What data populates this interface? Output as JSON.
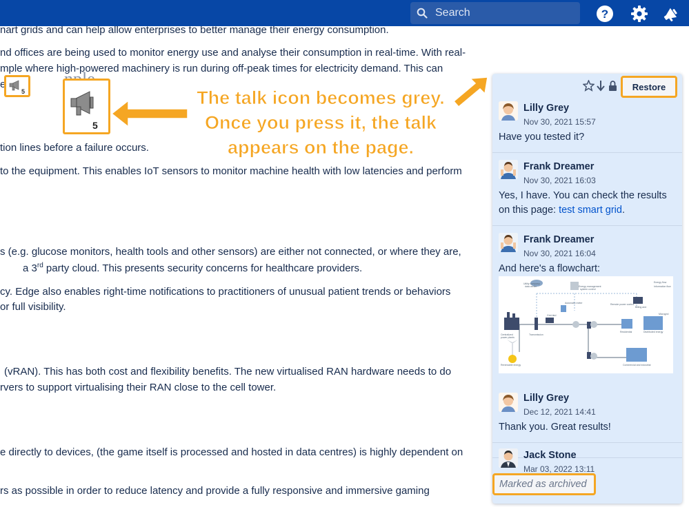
{
  "topbar": {
    "search_placeholder": "Search",
    "help_icon": "help-icon",
    "settings_icon": "gear-icon",
    "notifications_icon": "megaphone-icon",
    "background": "#0747a6"
  },
  "article": {
    "lines": [
      "nart grids and can help allow enterprises to better manage their energy consumption.",
      "nd offices are being used to monitor energy use and analyse their consumption in real-time. With real-",
      "mple where high-powered machinery is run during off-peak times for electricity demand. This can",
      "es",
      "tion lines before a failure occurs.",
      "to the equipment. This enables IoT sensors to monitor machine health with low latencies and perform",
      "s (e.g. glucose monitors, health tools and other sensors) are either not connected, or where they are,",
      "a 3",
      "rd",
      " party cloud. This presents security concerns for healthcare providers.",
      "cy. Edge also enables right-time notifications to practitioners of unusual patient trends or behaviors",
      "or full visibility.",
      "(vRAN). This has both cost and flexibility benefits. The new virtualised RAN hardware needs to do",
      "rvers to support virtualising their RAN close to the cell tower.",
      "e directly to devices, (the game itself is processed and hosted in data centres) is highly dependent on",
      "rs as possible in order to reduce latency and provide a fully responsive and immersive gaming"
    ],
    "faded_heading": "nple"
  },
  "annotation": {
    "callout_text": "The talk icon becomes grey. Once you press it, the talk appears on the page.",
    "talk_icon_small_count": "5",
    "talk_icon_large_count": "5",
    "accent_color": "#f5a623"
  },
  "talk_panel": {
    "restore_label": "Restore",
    "header_icons": [
      "star-icon",
      "arrow-down-icon",
      "lock-icon"
    ],
    "comments": [
      {
        "author": "Lilly Grey",
        "date": "Nov 30, 2021 15:57",
        "text": "Have you tested it?"
      },
      {
        "author": "Frank Dreamer",
        "date": "Nov 30, 2021 16:03",
        "text": "Yes, I have. You can check the results on this page: ",
        "link": "test smart grid",
        "after_link": "."
      },
      {
        "author": "Frank Dreamer",
        "date": "Nov 30, 2021 16:04",
        "text": "And here's a flowchart:"
      },
      {
        "author": "Lilly Grey",
        "date": "Dec 12, 2021 14:41",
        "text": "Thank you. Great results!"
      },
      {
        "author": "Jack Stone",
        "date": "Mar 03, 2022 13:11",
        "text": ""
      }
    ],
    "archived_label": "Marked as archived",
    "flowchart_labels": [
      "Utility company data center",
      "Energy management system control",
      "Centralized power plants",
      "Transmission",
      "Grid-tied storage",
      "Automatic meter reading",
      "Remote power control",
      "Billing and monitoring data",
      "Residential home loads",
      "Distributed energy resources and storage systems",
      "Renewable energy sources",
      "Commercial and industrial small buildings",
      "Advanced metering communication device",
      "Behind-the-meter storage",
      "Transport grid",
      "Microgrid",
      "Energy Flow",
      "Information flow"
    ]
  }
}
